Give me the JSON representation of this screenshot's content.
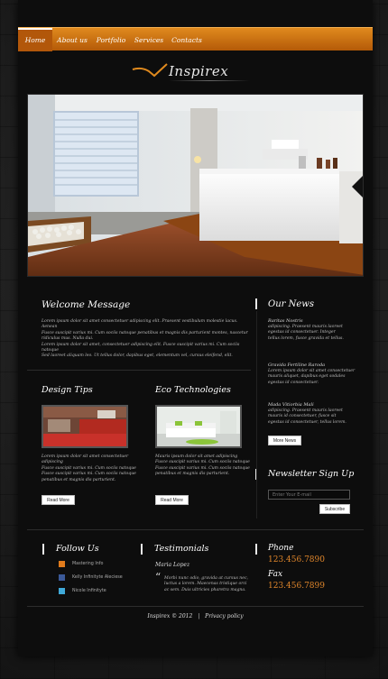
{
  "nav": {
    "items": [
      {
        "label": "Home"
      },
      {
        "label": "About us"
      },
      {
        "label": "Portfolio"
      },
      {
        "label": "Services"
      },
      {
        "label": "Contacts"
      }
    ]
  },
  "logo": {
    "text": "Inspirex"
  },
  "welcome": {
    "title": "Welcome Message",
    "body_lines": [
      "Lorem ipsum dolor sit amet consectetuer adipiscing elit. Praesent vestibulum molestie lacus. Aenean",
      "Fusce suscipit varius mi. Cum sociis natoque penatibus et magnis dis parturient montes, nascetur ridiculus mus. Nulla dui.",
      "Lorem ipsum dolor sit amet, consectetuer adipiscing elit. Fusce suscipit varius mi. Cum sociis natoque",
      "Sed laoreet aliquam leo. Ut tellus dolor, dapibus eget, elementum vel, cursus eleifend, elit."
    ]
  },
  "design_tips": {
    "title": "Design Tips",
    "body_lines": [
      "Lorem ipsum dolor sit amet consectetuer adipiscing",
      "Fusce suscipit varius mi. Cum sociis natoque",
      "Fusce suscipit varius mi. Cum sociis natoque",
      "penatibus et magnis dis parturient."
    ],
    "button": "Read More"
  },
  "eco_tech": {
    "title": "Eco Technologies",
    "body_lines": [
      "Mauris ipsum dolor sit amet adipiscing",
      "Fusce suscipit varius mi. Cum sociis natoque",
      "Fusce suscipit varius mi. Cum sociis natoque",
      "penatibus et magnis dis parturient."
    ],
    "button": "Read More"
  },
  "news": {
    "title": "Our News",
    "items": [
      {
        "date": "Raritas Nostris",
        "lines": [
          "adipiscing. Praesent mauris laoreet",
          "egestas id consectetuer. Integer",
          "tellus lorem, fusce gravida et tellus."
        ]
      },
      {
        "date": "Gravida Fertiline Raroda",
        "lines": [
          "Lorem ipsum dolor sit amet consectetuer",
          "mauris aliquet, dapibus eget sodales",
          "egestas id consectetuer."
        ]
      },
      {
        "date": "Mada Vitiorbia Mali",
        "lines": [
          "adipiscing. Praesent mauris laoreet",
          "mauris id consectetuer, fusce sit",
          "egestas id consectetuer, tellus lorem."
        ]
      }
    ],
    "button": "More News"
  },
  "newsletter": {
    "title": "Newsletter Sign Up",
    "placeholder": "Enter Your E-mail",
    "button": "Subscribe"
  },
  "follow": {
    "title": "Follow Us",
    "items": [
      {
        "label": "Mastering Info"
      },
      {
        "label": "Kelly Infinityte Aleciese"
      },
      {
        "label": "Nicole Infinityte"
      }
    ]
  },
  "testimonials": {
    "title": "Testimonials",
    "author": "Maria Lopez",
    "quote_lines": [
      "Morbi nunc odio, gravida at cursus nec,",
      "luctus a lorem. Maecenas tristique orci",
      "ac sem. Duis ultricies pharetra magna."
    ]
  },
  "contacts": {
    "phone_label": "Phone",
    "phone": "123.456.7890",
    "fax_label": "Fax",
    "fax": "123.456.7899"
  },
  "footer": {
    "brand": "Inspirex © 2012",
    "separator": "|",
    "privacy": "Privacy policy"
  },
  "colors": {
    "accent": "#e08a1e",
    "background": "#0d0d0d"
  },
  "icons": {
    "logo": "swoosh-icon",
    "hero_next": "arrow-right-icon",
    "rss": "rss-icon",
    "facebook": "facebook-icon",
    "twitter": "twitter-icon",
    "quote": "quote-icon"
  }
}
